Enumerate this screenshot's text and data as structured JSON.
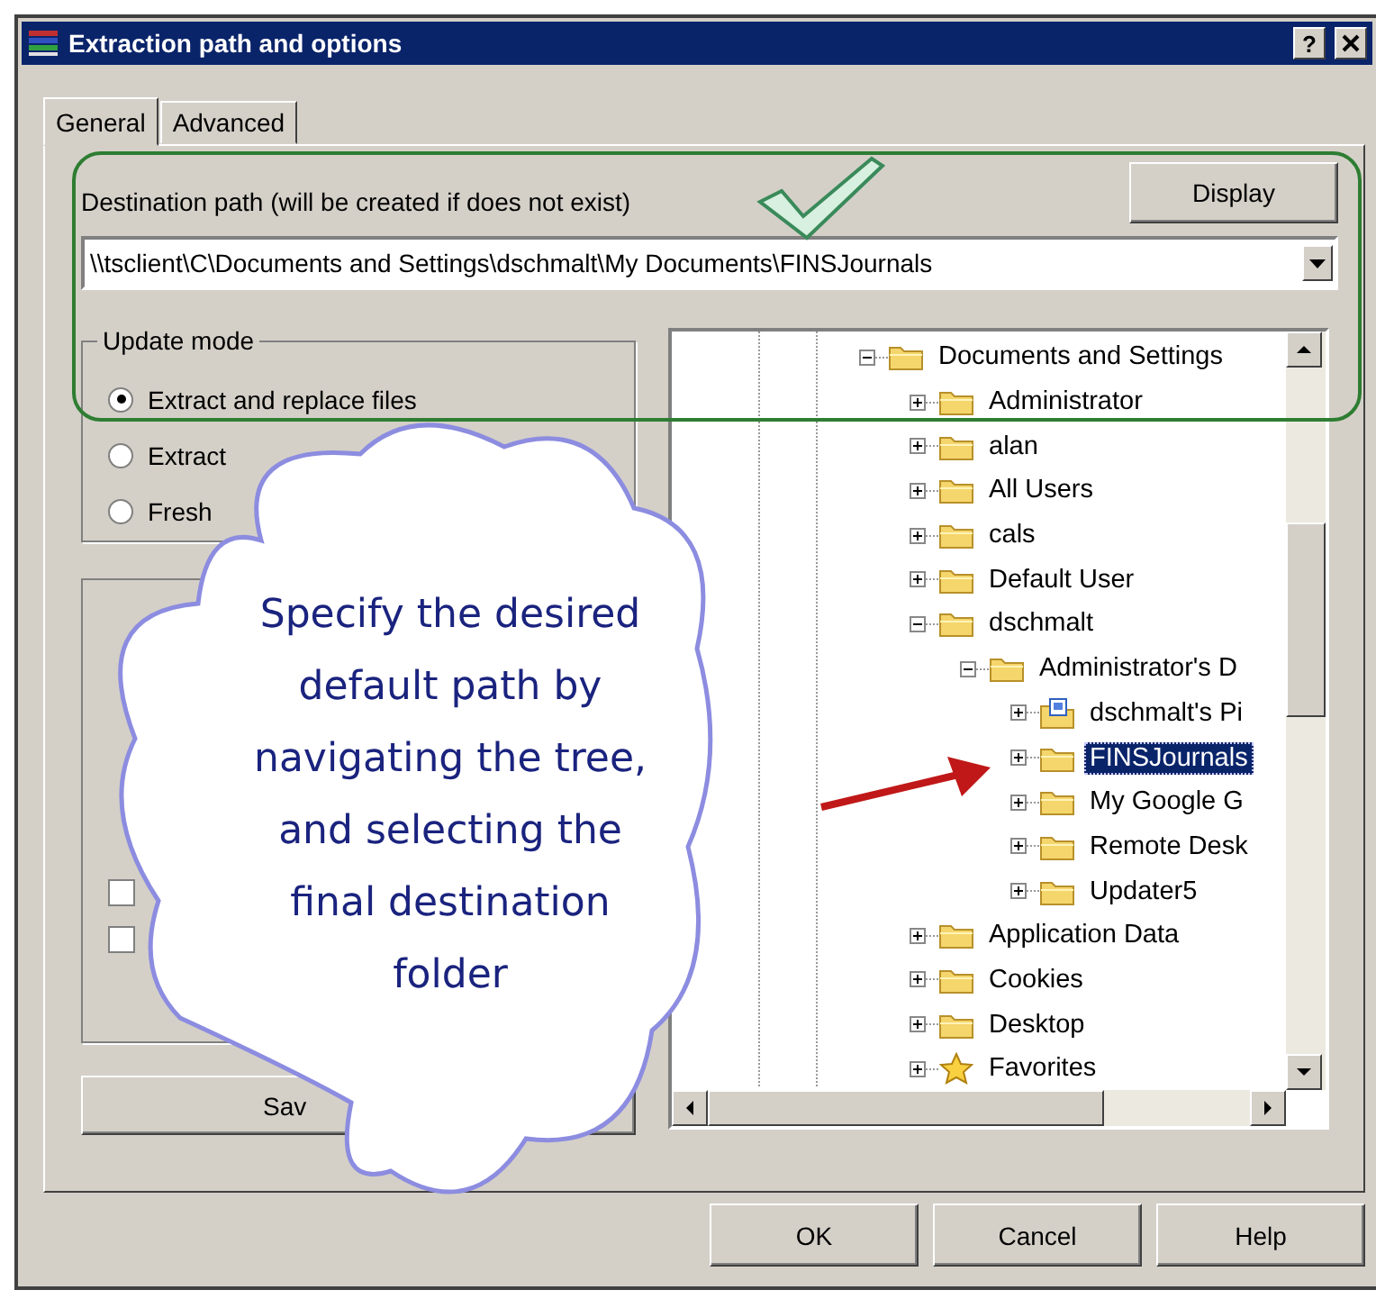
{
  "window": {
    "title": "Extraction path and options",
    "help_button": "?"
  },
  "tabs": [
    {
      "label": "General",
      "selected": true
    },
    {
      "label": "Advanced",
      "selected": false
    }
  ],
  "destination": {
    "label": "Destination path (will be created if does not exist)",
    "value": "\\\\tsclient\\C\\Documents and Settings\\dschmalt\\My Documents\\FINSJournals",
    "display_button": "Display"
  },
  "update_mode": {
    "title": "Update mode",
    "options": [
      {
        "label": "Extract and replace files",
        "selected": true
      },
      {
        "label": "Extract",
        "selected": false
      },
      {
        "label": "Fresh",
        "selected": false
      }
    ]
  },
  "options_group": {
    "checkboxes": [
      {
        "checked": false
      },
      {
        "checked": false
      }
    ]
  },
  "save_button": "Sav",
  "tree": [
    {
      "label": "Documents and Settings",
      "kind": "folder",
      "expanded": true,
      "selected": false,
      "children": [
        {
          "label": "Administrator",
          "kind": "folder",
          "expanded": false,
          "selected": false
        },
        {
          "label": "alan",
          "kind": "folder",
          "expanded": false,
          "selected": false
        },
        {
          "label": "All Users",
          "kind": "folder",
          "expanded": false,
          "selected": false
        },
        {
          "label": "cals",
          "kind": "folder",
          "expanded": false,
          "selected": false
        },
        {
          "label": "Default User",
          "kind": "folder",
          "expanded": false,
          "selected": false
        },
        {
          "label": "dschmalt",
          "kind": "folder",
          "expanded": true,
          "selected": false,
          "children": [
            {
              "label": "Administrator's D",
              "kind": "folder",
              "expanded": true,
              "selected": false,
              "children": [
                {
                  "label": "dschmalt's Pi",
                  "kind": "picture-folder",
                  "expanded": false,
                  "selected": false
                },
                {
                  "label": "FINSJournals",
                  "kind": "folder",
                  "expanded": false,
                  "selected": true
                },
                {
                  "label": "My Google G",
                  "kind": "folder",
                  "expanded": false,
                  "selected": false
                },
                {
                  "label": "Remote Desk",
                  "kind": "folder",
                  "expanded": false,
                  "selected": false
                },
                {
                  "label": "Updater5",
                  "kind": "folder",
                  "expanded": false,
                  "selected": false
                }
              ]
            }
          ]
        },
        {
          "label": "Application Data",
          "kind": "folder",
          "expanded": false,
          "selected": false
        },
        {
          "label": "Cookies",
          "kind": "folder",
          "expanded": false,
          "selected": false
        },
        {
          "label": "Desktop",
          "kind": "folder",
          "expanded": false,
          "selected": false
        },
        {
          "label": "Favorites",
          "kind": "star",
          "expanded": false,
          "selected": false
        }
      ]
    }
  ],
  "buttons": [
    "OK",
    "Cancel",
    "Help"
  ],
  "callout": {
    "lines": [
      "Specify the desired",
      "default path by",
      "navigating the tree,",
      "and selecting the",
      "final destination",
      "folder"
    ]
  }
}
